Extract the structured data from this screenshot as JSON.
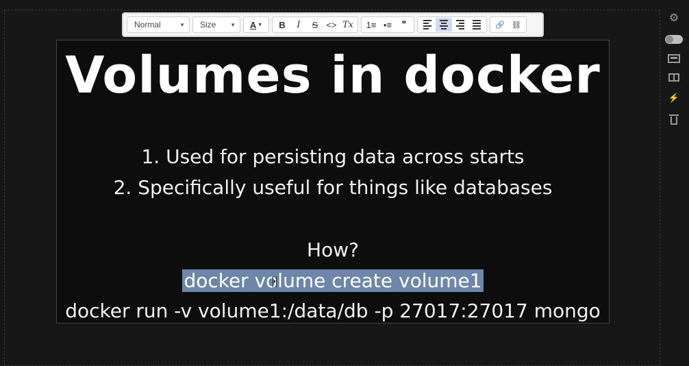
{
  "toolbar": {
    "format_select": "Normal",
    "size_select": "Size",
    "text_color_label": "A",
    "bold_label": "B",
    "italic_label": "I",
    "strike_label": "S",
    "code_label": "<>",
    "clean_label": "Tx",
    "ordered_list_label": "1≡",
    "bullet_list_label": "•≡",
    "quote_label": "❞",
    "align_active": "center",
    "link_label": "🔗",
    "unlink_label": "⛓"
  },
  "slide": {
    "title": "Volumes in docker",
    "line_1": "1. Used for persisting data across starts",
    "line_2": "2. Specifically useful for things like databases",
    "line_3": "How?",
    "line_4": "docker volume create volume1",
    "line_5": "docker run -v volume1:/data/db -p 27017:27017 mongo"
  },
  "sidebar": {
    "icons": [
      "gear-icon",
      "toggle-icon",
      "monitor-icon",
      "book-icon",
      "lightning-icon",
      "trash-icon"
    ],
    "gear_glyph": "⚙",
    "lightning_glyph": "⚡"
  },
  "colors": {
    "background": "#171717",
    "slide_background": "#0d0d0e",
    "selection": "#6d86a9",
    "toolbar": "#f6f6f6"
  }
}
